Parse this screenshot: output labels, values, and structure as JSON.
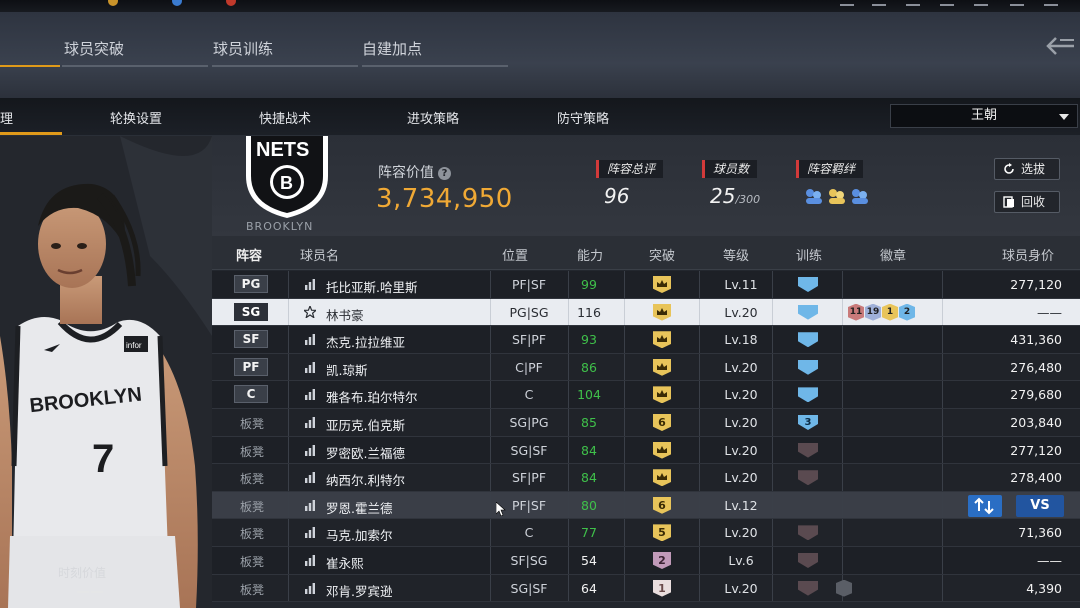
{
  "header": {
    "tabs": [
      {
        "label": "球员突破",
        "active": true
      },
      {
        "label": "球员训练",
        "active": false
      },
      {
        "label": "自建加点",
        "active": false
      }
    ]
  },
  "subnav": {
    "active_partial": "理",
    "tabs": [
      "轮换设置",
      "快捷战术",
      "进攻策略",
      "防守策略"
    ],
    "dynasty_select": "王朝"
  },
  "hero": {
    "value_label": "时刻价值",
    "value": "——"
  },
  "summary": {
    "team_caption": "BROOKLYN",
    "lineup_value_label": "阵容价值",
    "lineup_value": "3,734,950",
    "overall_label": "阵容总评",
    "overall": "96",
    "player_count_label": "球员数",
    "player_count": "25",
    "player_cap": "/300",
    "bond_label": "阵容羁绊",
    "select_btn": "选拔",
    "recycle_btn": "回收"
  },
  "table": {
    "headers": [
      "阵容",
      "球员名",
      "位置",
      "能力",
      "突破",
      "等级",
      "训练",
      "徽章",
      "球员身价"
    ],
    "rows": [
      {
        "slot": "PG",
        "starter": true,
        "name": "托比亚斯.哈里斯",
        "pos": "PF|SF",
        "rating": "99",
        "breakthrough": "",
        "level": "Lv.11",
        "training": "",
        "price": "277,120"
      },
      {
        "slot": "SG",
        "starter": true,
        "name": "林书豪",
        "pos": "PG|SG",
        "rating": "116",
        "breakthrough": "",
        "level": "Lv.20",
        "training": "",
        "badges": [
          "11",
          "19",
          "1",
          "2"
        ],
        "price": "——"
      },
      {
        "slot": "SF",
        "starter": true,
        "name": "杰克.拉拉维亚",
        "pos": "SF|PF",
        "rating": "93",
        "breakthrough": "",
        "level": "Lv.18",
        "training": "",
        "price": "431,360"
      },
      {
        "slot": "PF",
        "starter": true,
        "name": "凯.琼斯",
        "pos": "C|PF",
        "rating": "86",
        "breakthrough": "",
        "level": "Lv.20",
        "training": "",
        "price": "276,480"
      },
      {
        "slot": "C",
        "starter": true,
        "name": "雅各布.珀尔特尔",
        "pos": "C",
        "rating": "104",
        "breakthrough": "",
        "level": "Lv.20",
        "training": "",
        "price": "279,680"
      },
      {
        "slot": "板凳",
        "starter": false,
        "name": "亚历克.伯克斯",
        "pos": "SG|PG",
        "rating": "85",
        "breakthrough": "6",
        "level": "Lv.20",
        "training": "3",
        "price": "203,840"
      },
      {
        "slot": "板凳",
        "starter": false,
        "name": "罗密欧.兰福德",
        "pos": "SG|SF",
        "rating": "84",
        "breakthrough": "",
        "level": "Lv.20",
        "training": "",
        "price": "277,120"
      },
      {
        "slot": "板凳",
        "starter": false,
        "name": "纳西尔.利特尔",
        "pos": "SF|PF",
        "rating": "84",
        "breakthrough": "",
        "level": "Lv.20",
        "training": "",
        "price": "278,400"
      },
      {
        "slot": "板凳",
        "starter": false,
        "name": "罗恩.霍兰德",
        "pos": "PF|SF",
        "rating": "80",
        "breakthrough": "6",
        "level": "Lv.12",
        "training": "",
        "price": "",
        "compare": "VS"
      },
      {
        "slot": "板凳",
        "starter": false,
        "name": "马克.加索尔",
        "pos": "C",
        "rating": "77",
        "breakthrough": "5",
        "level": "Lv.20",
        "training": "",
        "price": "71,360"
      },
      {
        "slot": "板凳",
        "starter": false,
        "name": "崔永熙",
        "pos": "SF|SG",
        "rating": "54",
        "breakthrough": "2",
        "level": "Lv.6",
        "training": "",
        "price": "——"
      },
      {
        "slot": "板凳",
        "starter": false,
        "name": "邓肯.罗宾逊",
        "pos": "SG|SF",
        "rating": "64",
        "breakthrough": "1",
        "level": "Lv.20",
        "training": "",
        "price": "4,390"
      }
    ]
  },
  "colors": {
    "accent_orange": "#e09a1a",
    "value_gold": "#f0a935",
    "rating_green": "#3fc04a",
    "tag_red": "#d23a3a",
    "train_blue": "#6fb7e8",
    "vs_blue": "#2255a0"
  }
}
